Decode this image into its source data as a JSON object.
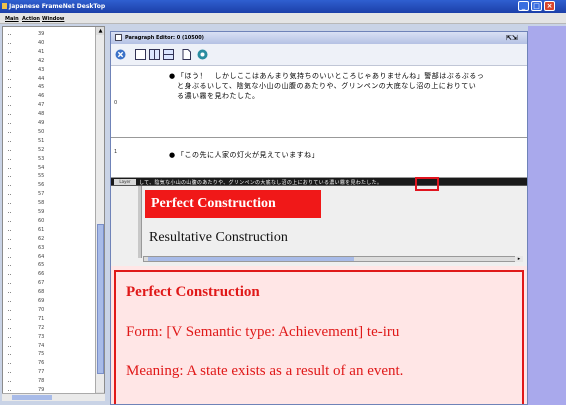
{
  "window": {
    "title": "Japanese FrameNet DeskTop"
  },
  "menu": [
    {
      "label": "Main"
    },
    {
      "label": "Action"
    },
    {
      "label": "Window"
    }
  ],
  "sidebar": {
    "rows": [
      "39",
      "40",
      "41",
      "42",
      "43",
      "44",
      "45",
      "46",
      "47",
      "48",
      "49",
      "50",
      "51",
      "52",
      "53",
      "54",
      "55",
      "56",
      "57",
      "58",
      "59",
      "60",
      "61",
      "62",
      "63",
      "64",
      "65",
      "66",
      "67",
      "68",
      "69",
      "70",
      "71",
      "72",
      "73",
      "74",
      "75",
      "76",
      "77",
      "78",
      "79"
    ]
  },
  "editor": {
    "title": "Paragraph Editor: 0 (10500)",
    "paragraphs": [
      {
        "num": "0",
        "lines": [
          "「ほう！　しかしここはあんまり気持ちのいいところじゃありませんね」警部はぶるぶるっ",
          "と身ぶるいして、陰気な小山の山腹のあたりや、グリンペンの大底なし沼の上におりてい",
          "る濃い霧を見わたした。"
        ]
      },
      {
        "num": "1",
        "lines": [
          "「この先に人家の灯火が見えていますね」"
        ]
      }
    ],
    "sentence_strip": "して、陰気な小山の山腹のあたりや、グリンペンの大底なし沼の上におりている濃い霧を見わたした。",
    "layer_label": "Layer",
    "frames": {
      "selected": "Perfect Construction",
      "other": "Resultative Construction"
    },
    "definition": {
      "heading": "Perfect Construction",
      "form": "Form: [V Semantic type: Achievement] te-iru",
      "meaning": "Meaning: A state exists as a result of an event."
    }
  }
}
